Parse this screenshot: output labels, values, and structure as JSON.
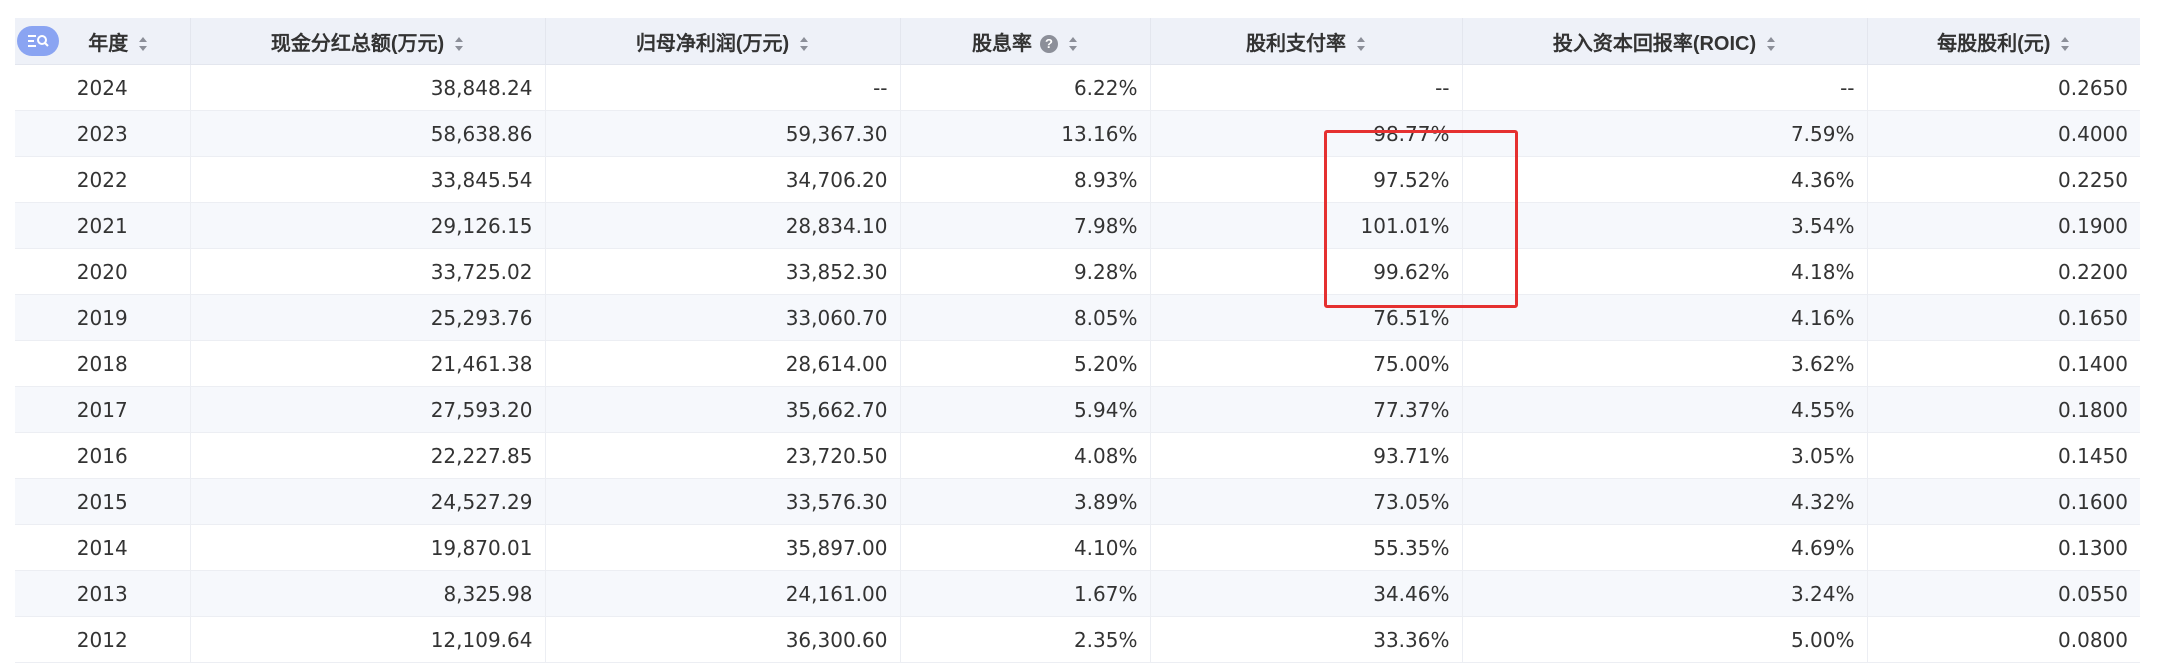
{
  "table": {
    "headers": [
      {
        "label": "年度",
        "sortable": true
      },
      {
        "label": "现金分红总额(万元)",
        "sortable": true
      },
      {
        "label": "归母净利润(万元)",
        "sortable": true
      },
      {
        "label": "股息率",
        "sortable": true,
        "help": true
      },
      {
        "label": "股利支付率",
        "sortable": true
      },
      {
        "label": "投入资本回报率(ROIC)",
        "sortable": true
      },
      {
        "label": "每股股利(元)",
        "sortable": true
      }
    ],
    "rows": [
      [
        "2024",
        "38,848.24",
        "--",
        "6.22%",
        "--",
        "--",
        "0.2650"
      ],
      [
        "2023",
        "58,638.86",
        "59,367.30",
        "13.16%",
        "98.77%",
        "7.59%",
        "0.4000"
      ],
      [
        "2022",
        "33,845.54",
        "34,706.20",
        "8.93%",
        "97.52%",
        "4.36%",
        "0.2250"
      ],
      [
        "2021",
        "29,126.15",
        "28,834.10",
        "7.98%",
        "101.01%",
        "3.54%",
        "0.1900"
      ],
      [
        "2020",
        "33,725.02",
        "33,852.30",
        "9.28%",
        "99.62%",
        "4.18%",
        "0.2200"
      ],
      [
        "2019",
        "25,293.76",
        "33,060.70",
        "8.05%",
        "76.51%",
        "4.16%",
        "0.1650"
      ],
      [
        "2018",
        "21,461.38",
        "28,614.00",
        "5.20%",
        "75.00%",
        "3.62%",
        "0.1400"
      ],
      [
        "2017",
        "27,593.20",
        "35,662.70",
        "5.94%",
        "77.37%",
        "4.55%",
        "0.1800"
      ],
      [
        "2016",
        "22,227.85",
        "23,720.50",
        "4.08%",
        "93.71%",
        "3.05%",
        "0.1450"
      ],
      [
        "2015",
        "24,527.29",
        "33,576.30",
        "3.89%",
        "73.05%",
        "4.32%",
        "0.1600"
      ],
      [
        "2014",
        "19,870.01",
        "35,897.00",
        "4.10%",
        "55.35%",
        "4.69%",
        "0.1300"
      ],
      [
        "2013",
        "8,325.98",
        "24,161.00",
        "1.67%",
        "34.46%",
        "3.24%",
        "0.0550"
      ],
      [
        "2012",
        "12,109.64",
        "36,300.60",
        "2.35%",
        "33.36%",
        "5.00%",
        "0.0800"
      ]
    ],
    "help_glyph": "?",
    "highlight": {
      "column": "股利支付率",
      "years": [
        "2023",
        "2022",
        "2021",
        "2020"
      ],
      "color": "#e53030"
    }
  },
  "icons": {
    "column_toggle": "column-settings-icon",
    "sort": "sort-icon",
    "help": "help-icon"
  },
  "colors": {
    "header_bg": "#eef1f8",
    "stripe_bg": "#f6f8fc",
    "toggle_bg": "#8aa4f2",
    "highlight": "#e53030"
  }
}
